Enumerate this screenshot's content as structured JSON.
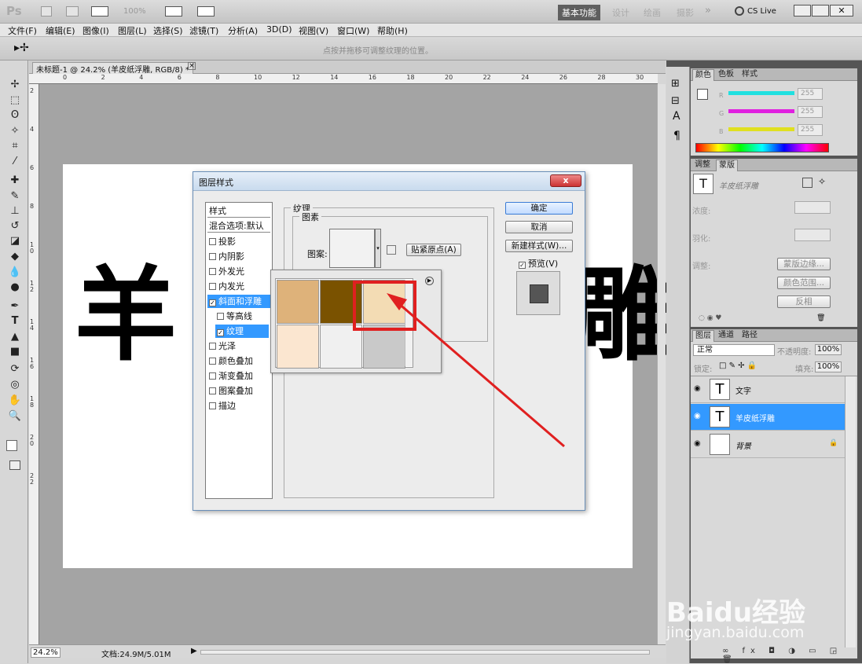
{
  "app": {
    "logo": "Ps",
    "zoom": "100%",
    "workspaces": [
      "基本功能",
      "设计",
      "绘画",
      "摄影"
    ],
    "more_label": "»",
    "cslive": "CS Live"
  },
  "menubar": [
    "文件(F)",
    "编辑(E)",
    "图像(I)",
    "图层(L)",
    "选择(S)",
    "滤镜(T)",
    "分析(A)",
    "3D(D)",
    "视图(V)",
    "窗口(W)",
    "帮助(H)"
  ],
  "options_bar": {
    "hint": "点按并拖移可调整纹理的位置。"
  },
  "document": {
    "tab_title": "未标题-1 @ 24.2% (羊皮纸浮雕, RGB/8) *",
    "ruler_labels": [
      "0",
      "2",
      "4",
      "6",
      "8",
      "10",
      "12",
      "14",
      "16",
      "18",
      "20",
      "22",
      "24",
      "26",
      "28",
      "30"
    ],
    "ruler_v_labels": [
      "2",
      "4",
      "6",
      "8",
      "1\n0",
      "1\n2",
      "1\n4",
      "1\n6",
      "1\n8",
      "2\n0",
      "2\n2"
    ],
    "canvas_text": [
      "羊",
      "雕"
    ],
    "status": {
      "zoom": "24.2%",
      "doc": "文档:24.9M/5.01M"
    }
  },
  "dialog": {
    "title": "图层样式",
    "close": "x",
    "styles_header": "样式",
    "blend_options": "混合选项:默认",
    "items": [
      {
        "label": "投影",
        "checked": false
      },
      {
        "label": "内阴影",
        "checked": false
      },
      {
        "label": "外发光",
        "checked": false
      },
      {
        "label": "内发光",
        "checked": false
      },
      {
        "label": "斜面和浮雕",
        "checked": true,
        "selected": true
      },
      {
        "label": "等高线",
        "checked": false,
        "sub": true
      },
      {
        "label": "纹理",
        "checked": true,
        "sub": true,
        "selected": true
      },
      {
        "label": "光泽",
        "checked": false
      },
      {
        "label": "颜色叠加",
        "checked": false
      },
      {
        "label": "渐变叠加",
        "checked": false
      },
      {
        "label": "图案叠加",
        "checked": false
      },
      {
        "label": "描边",
        "checked": false
      }
    ],
    "texture_group": "纹理",
    "pattern_group": "图素",
    "pattern_label": "图案:",
    "snap_origin": "贴紧原点(A)",
    "ok": "确定",
    "cancel": "取消",
    "new_style": "新建样式(W)...",
    "preview": "预览(V)",
    "preview_checked": "✓",
    "patterns": [
      {
        "color": "#deb27a"
      },
      {
        "color": "#7a5200"
      },
      {
        "color": "#f3dcb4",
        "selected": true
      },
      {
        "color": "#fbe6d0"
      },
      {
        "color": "#f0f0f0"
      },
      {
        "color": "#c9c9c9"
      }
    ]
  },
  "color_panel": {
    "tabs": [
      "颜色",
      "色板",
      "样式"
    ],
    "sliders": [
      {
        "label": "R",
        "value": "255",
        "color": "#20e0e0"
      },
      {
        "label": "G",
        "value": "255",
        "color": "#e020e0"
      },
      {
        "label": "B",
        "value": "255",
        "color": "#e0e020"
      }
    ]
  },
  "adjust_panel": {
    "tabs": [
      "调整",
      "蒙版"
    ],
    "layer_name": "羊皮纸浮雕",
    "density": "浓度:",
    "feather": "羽化:",
    "refine": "调整:",
    "buttons": [
      "蒙版边缘...",
      "颜色范围...",
      "反相"
    ]
  },
  "layers_panel": {
    "tabs": [
      "图层",
      "通道",
      "路径"
    ],
    "mode": "正常",
    "opacity_label": "不透明度:",
    "opacity": "100%",
    "lock_label": "锁定:",
    "fill_label": "填充:",
    "fill": "100%",
    "layers": [
      {
        "name": "文字",
        "type": "text",
        "selected": false
      },
      {
        "name": "羊皮纸浮雕",
        "type": "text",
        "selected": true
      },
      {
        "name": "背景",
        "type": "background",
        "selected": false
      }
    ]
  },
  "watermark": {
    "brand": "Baidu经验",
    "url": "jingyan.baidu.com"
  },
  "colors": {
    "accent": "#3399ff",
    "annotation": "#e02020"
  }
}
